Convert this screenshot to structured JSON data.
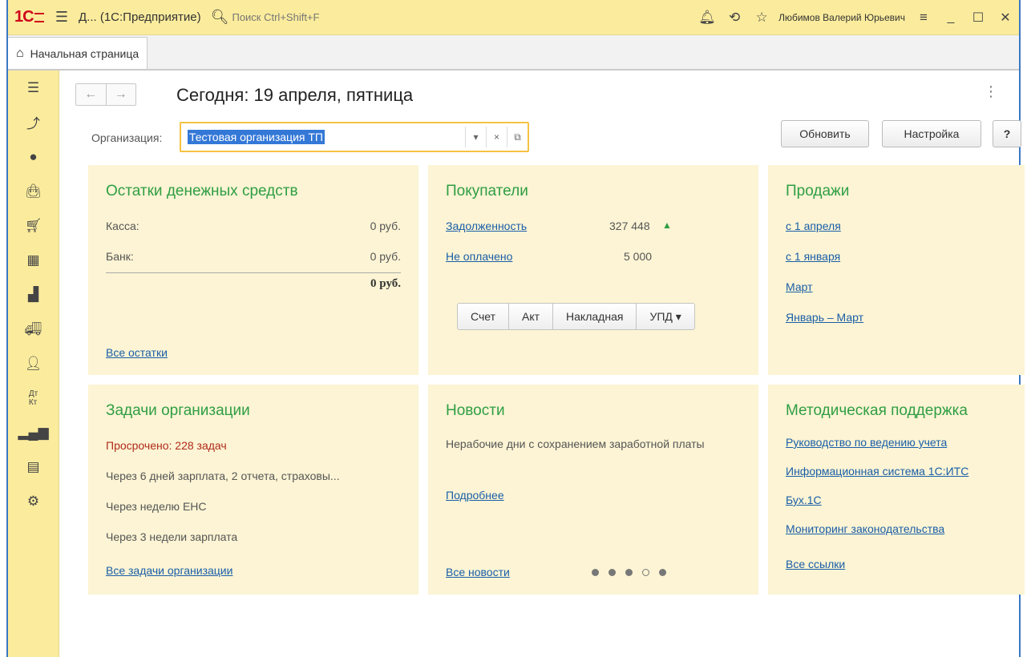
{
  "titlebar": {
    "logo": "1С",
    "title": "Д... (1С:Предприятие)",
    "search_placeholder": "Поиск Ctrl+Shift+F",
    "user": "Любимов Валерий Юрьевич"
  },
  "tabs": [
    {
      "label": "Начальная страница"
    }
  ],
  "page": {
    "title": "Сегодня: 19 апреля, пятница",
    "org_label": "Организация:",
    "org_value": "Тестовая организация ТП",
    "refresh_label": "Обновить",
    "settings_label": "Настройка",
    "help_label": "?"
  },
  "cash": {
    "title": "Остатки денежных средств",
    "rows": [
      {
        "label": "Касса:",
        "value": "0 руб."
      },
      {
        "label": "Банк:",
        "value": "0 руб."
      }
    ],
    "total": "0 руб.",
    "all_link": "Все остатки"
  },
  "buyers": {
    "title": "Покупатели",
    "debt_label": "Задолженность",
    "debt_value": "327 448",
    "unpaid_label": "Не оплачено",
    "unpaid_value": "5 000",
    "buttons": [
      "Счет",
      "Акт",
      "Накладная",
      "УПД ▾"
    ]
  },
  "sales": {
    "title": "Продажи",
    "links": [
      "с 1 апреля",
      "с 1 января",
      "Март",
      "Январь – Март"
    ]
  },
  "tasks": {
    "title": "Задачи организации",
    "overdue": "Просрочено: 228 задач",
    "items": [
      "Через 6 дней зарплата, 2 отчета, страховы...",
      "Через неделю ЕНС",
      "Через 3 недели зарплата"
    ],
    "all_link": "Все задачи организации"
  },
  "news": {
    "title": "Новости",
    "text": "Нерабочие дни с сохранением заработной платы",
    "more_link": "Подробнее",
    "all_link": "Все новости",
    "pager": [
      true,
      true,
      true,
      false,
      true
    ]
  },
  "support": {
    "title": "Методическая поддержка",
    "links": [
      "Руководство по ведению учета",
      "Информационная система 1С:ИТС",
      "Бух.1С",
      "Мониторинг законодательства"
    ],
    "all_link": "Все ссылки"
  },
  "colors": {
    "accent_yellow": "#fbec9d",
    "panel_bg": "#fcf4d4",
    "title_green": "#2f9e44",
    "link_blue": "#1a5ea8",
    "overdue_red": "#b02a1a"
  }
}
